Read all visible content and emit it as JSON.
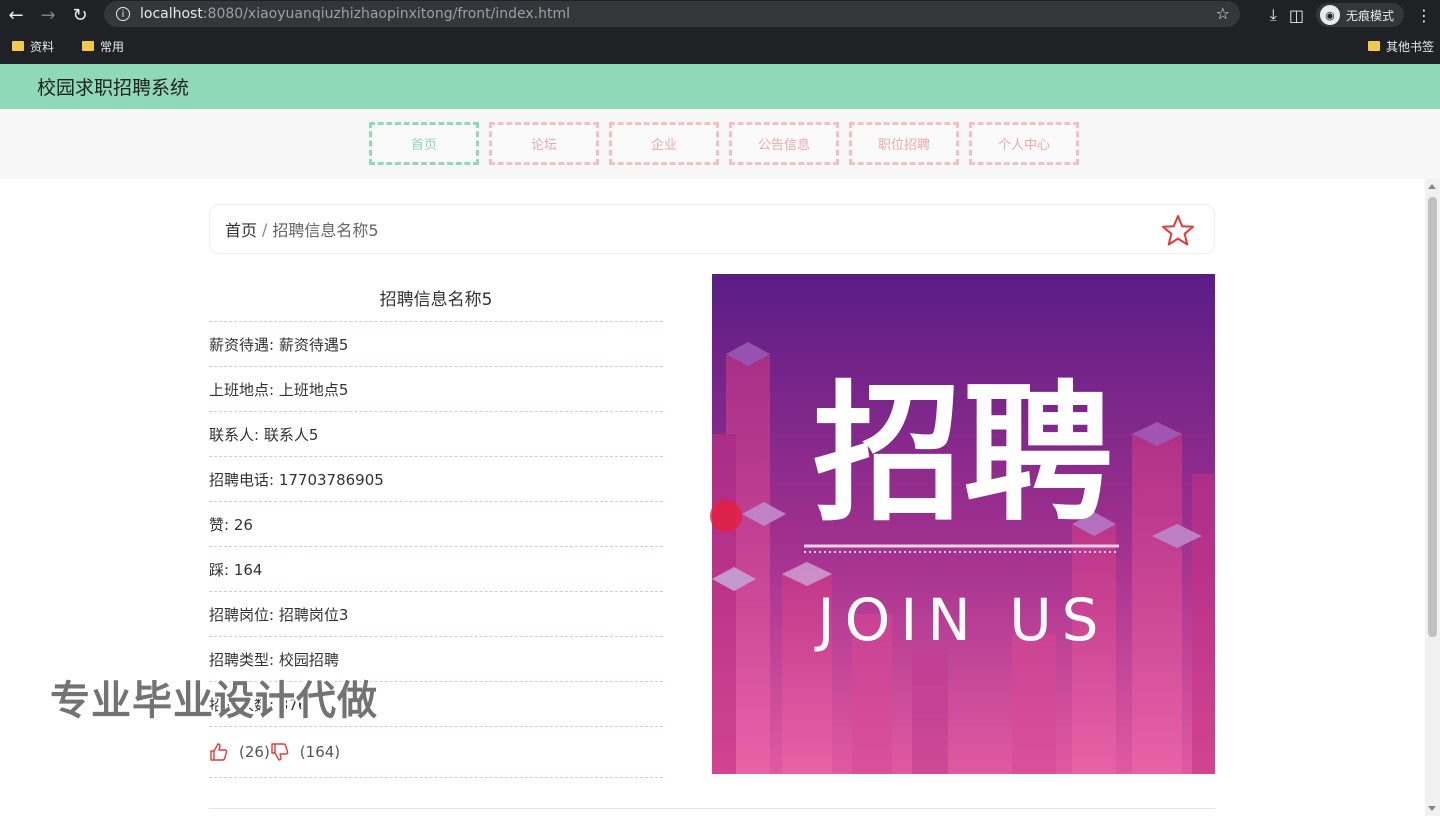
{
  "browser": {
    "url_host": "localhost",
    "url_path": ":8080/xiaoyuanqiuzhizhaopinxitong/front/index.html",
    "incognito_label": "无痕模式",
    "bookmarks": [
      "资料",
      "常用"
    ],
    "bookmark_other": "其他书签"
  },
  "site": {
    "title": "校园求职招聘系统",
    "menu": [
      {
        "label": "首页",
        "active": true
      },
      {
        "label": "论坛",
        "active": false
      },
      {
        "label": "企业",
        "active": false
      },
      {
        "label": "公告信息",
        "active": false
      },
      {
        "label": "职位招聘",
        "active": false
      },
      {
        "label": "个人中心",
        "active": false
      }
    ]
  },
  "breadcrumb": {
    "home": "首页",
    "separator": "/",
    "current": "招聘信息名称5"
  },
  "detail": {
    "title": "招聘信息名称5",
    "fields": [
      "薪资待遇: 薪资待遇5",
      "上班地点: 上班地点5",
      "联系人: 联系人5",
      "招聘电话: 17703786905",
      "赞: 26",
      "踩: 164",
      "招聘岗位: 招聘岗位3",
      "招聘类型: 校园招聘",
      "招聘人数: 376"
    ],
    "likes": "(26)",
    "dislikes": "(164)"
  },
  "poster": {
    "headline": "招聘",
    "subline": "JOIN US",
    "bg_top": "#5a1d86",
    "bg_bottom": "#e05aa0"
  },
  "watermark": "专业毕业设计代做",
  "colors": {
    "header_bg": "#8fd9b6",
    "menu_border": "#f2c1c1",
    "accent_red": "#e53935"
  }
}
